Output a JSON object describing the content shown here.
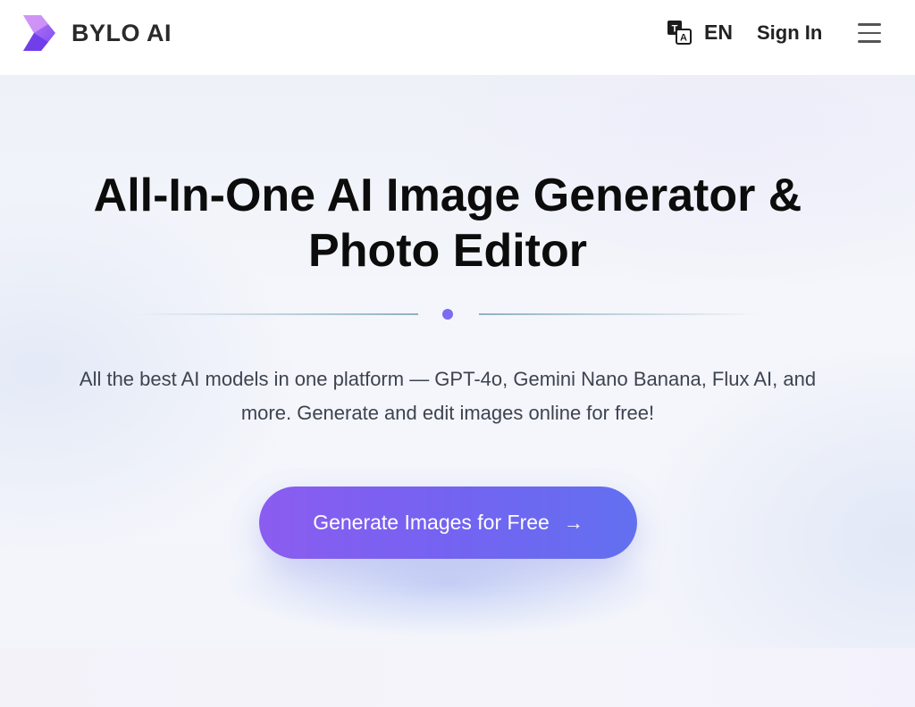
{
  "header": {
    "brand": "BYLO AI",
    "language": "EN",
    "sign_in": "Sign In",
    "icons": {
      "logo": "bylo-logo-icon",
      "translate": "translate-icon",
      "menu": "hamburger-menu-icon"
    }
  },
  "hero": {
    "title_line1": "All-In-One AI Image Generator &",
    "title_line2": "Photo Editor",
    "subtitle_line1": "All the best AI models in one platform — GPT-4o, Gemini Nano Banana, Flux AI, and",
    "subtitle_line2": "more. Generate and edit images online for free!",
    "cta_label": "Generate Images for Free",
    "cta_arrow": "→"
  },
  "colors": {
    "accent": "#7b6cf0",
    "cta_start": "#8b5cf0",
    "cta_end": "#6270f0"
  }
}
